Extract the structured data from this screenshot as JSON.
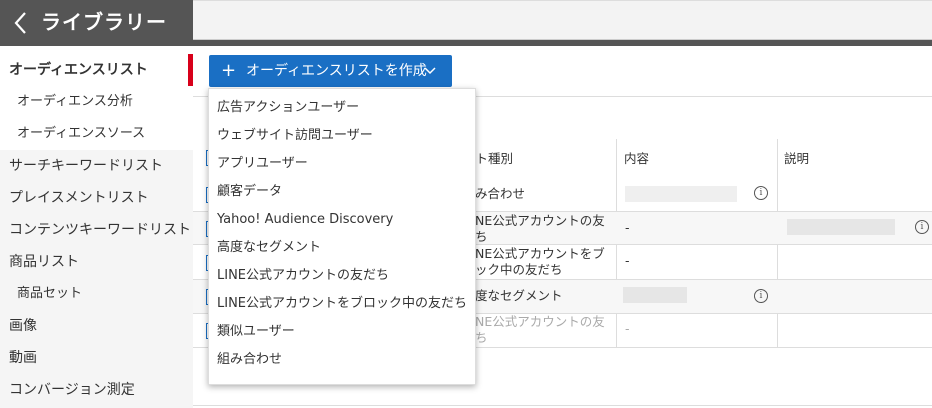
{
  "header": {
    "title": "ライブラリー"
  },
  "sidebar": {
    "items": [
      {
        "label": "オーディエンスリスト"
      },
      {
        "label": "オーディエンス分析"
      },
      {
        "label": "オーディエンスソース"
      },
      {
        "label": "サーチキーワードリスト"
      },
      {
        "label": "プレイスメントリスト"
      },
      {
        "label": "コンテンツキーワードリスト"
      },
      {
        "label": "商品リスト"
      },
      {
        "label": "商品セット"
      },
      {
        "label": "画像"
      },
      {
        "label": "動画"
      },
      {
        "label": "コンバージョン測定"
      }
    ]
  },
  "toolbar": {
    "create_label": "オーディエンスリストを作成"
  },
  "dropdown": {
    "items": [
      "広告アクションユーザー",
      "ウェブサイト訪問ユーザー",
      "アプリユーザー",
      "顧客データ",
      "Yahoo! Audience Discovery",
      "高度なセグメント",
      "LINE公式アカウントの友だち",
      "LINE公式アカウントをブロック中の友だち",
      "類似ユーザー",
      "組み合わせ"
    ]
  },
  "table": {
    "headers": [
      "スト種別",
      "内容",
      "説明"
    ],
    "rows": [
      {
        "type": "み合わせ",
        "content": ""
      },
      {
        "type": "NE公式アカウントの友\nち",
        "content": "-"
      },
      {
        "type": "NE公式アカウントをブ\nック中の友だち",
        "content": "-"
      },
      {
        "type": "度なセグメント",
        "content": ""
      },
      {
        "type": "NE公式アカウントの友\nち",
        "content": "-"
      }
    ]
  },
  "colors": {
    "accent": "#1a6fc4",
    "active_marker": "#d8001a",
    "header_bg": "#555555"
  }
}
